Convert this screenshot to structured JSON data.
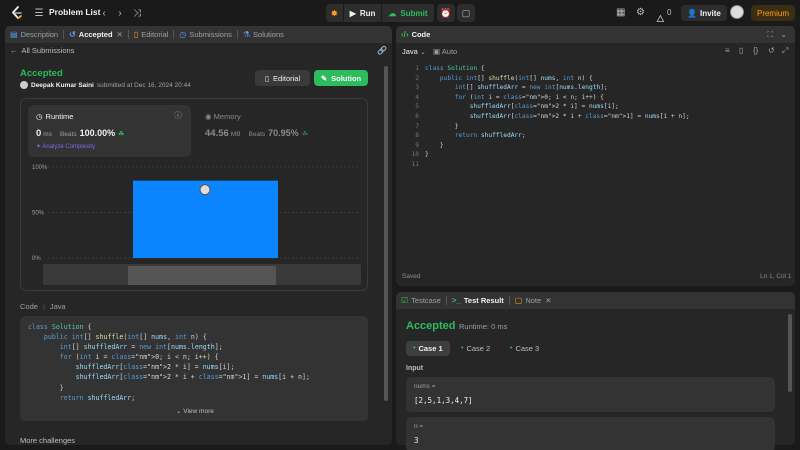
{
  "topbar": {
    "problem_list": "Problem List",
    "run": "Run",
    "submit": "Submit",
    "streak": "0",
    "invite": "Invite",
    "premium": "Premium"
  },
  "left_tabs": [
    {
      "label": "Description",
      "icon": "description-icon"
    },
    {
      "label": "Accepted",
      "icon": "history-icon",
      "active": true,
      "closable": true
    },
    {
      "label": "Editorial",
      "icon": "book-icon"
    },
    {
      "label": "Submissions",
      "icon": "clock-icon"
    },
    {
      "label": "Solutions",
      "icon": "flask-icon"
    }
  ],
  "submission": {
    "back_label": "All Submissions",
    "status": "Accepted",
    "author": "Deepak Kumar Saini",
    "submitted_text": "submitted at Dec 16, 2024 20:44",
    "editorial_btn": "Editorial",
    "solution_btn": "Solution",
    "runtime": {
      "title": "Runtime",
      "value": "0",
      "unit": "ms",
      "beats_label": "Beats",
      "beats_pct": "100.00%",
      "analyze": "Analyze Complexity"
    },
    "memory": {
      "title": "Memory",
      "value": "44.56",
      "unit": "MB",
      "beats_label": "Beats",
      "beats_pct": "70.95%"
    },
    "code_label": "Code",
    "code_lang": "Java",
    "view_more": "View more",
    "more_challenges": "More challenges"
  },
  "chart_data": {
    "type": "bar",
    "yticks": [
      "100%",
      "50%",
      "0%"
    ],
    "ylim": [
      0,
      100
    ],
    "values": [
      85
    ],
    "color": "#0a84ff",
    "grid": true
  },
  "code_panel": {
    "title": "Code",
    "lang": "Java",
    "auto": "Auto",
    "saved": "Saved",
    "cursor": "Ln 1, Col 1",
    "lines": [
      "class Solution {",
      "    public int[] shuffle(int[] nums, int n) {",
      "        int[] shuffledArr = new int[nums.length];",
      "        for (int i = 0; i < n; i++) {",
      "            shuffledArr[2 * i] = nums[i];",
      "            shuffledArr[2 * i + 1] = nums[i + n];",
      "        }",
      "        return shuffledArr;",
      "    }",
      "}",
      ""
    ]
  },
  "test_tabs": [
    {
      "label": "Testcase",
      "icon": "checkbox-icon"
    },
    {
      "label": "Test Result",
      "icon": "terminal-icon",
      "active": true
    },
    {
      "label": "Note",
      "icon": "note-icon",
      "closable": true
    }
  ],
  "test_result": {
    "status": "Accepted",
    "runtime": "Runtime: 0 ms",
    "cases": [
      "Case 1",
      "Case 2",
      "Case 3"
    ],
    "input_label": "Input",
    "vars": [
      {
        "name": "nums =",
        "value": "[2,5,1,3,4,7]"
      },
      {
        "name": "n =",
        "value": "3"
      }
    ]
  }
}
